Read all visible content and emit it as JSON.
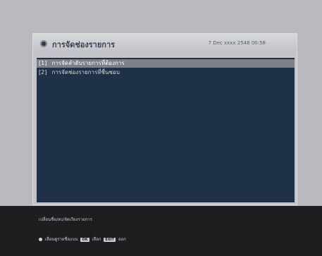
{
  "window": {
    "title": "การจัดช่องรายการ",
    "datetime": "7 Dec xxxx 2548 00:58"
  },
  "menu": {
    "items": [
      {
        "number": "[1]",
        "label": "การจัดลำดับรายการที่ต้องการ"
      },
      {
        "number": "[2]",
        "label": "การจัดช่องรายการที่ชื่นชอบ"
      }
    ]
  },
  "status": {
    "hint_line1": "เปลี่ยนชื่อ/ลบ/จัดเรียงรายการ",
    "hint_line2_prefix": "เลื่อนดูรายชื่อแบบ",
    "key_ok": "OK",
    "select_label": "เลือก",
    "key_exit": "EXIT",
    "exit_label": "ออก"
  }
}
